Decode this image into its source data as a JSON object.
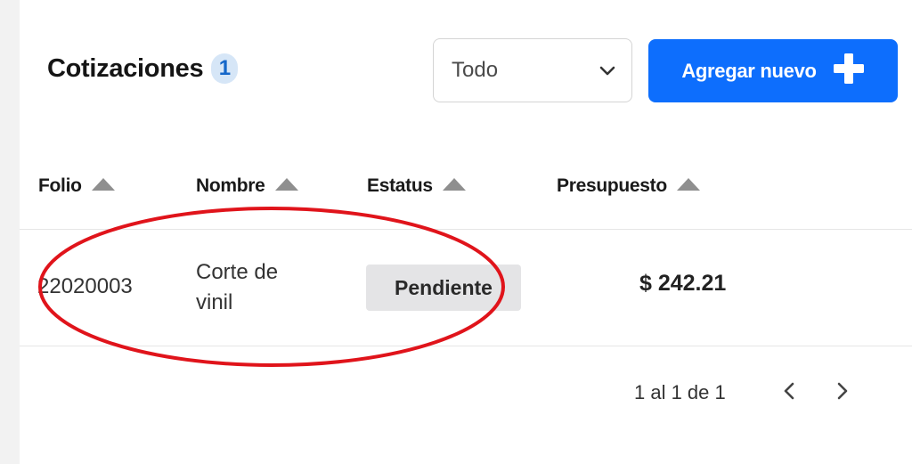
{
  "header": {
    "title": "Cotizaciones",
    "count": "1",
    "filter": {
      "selected": "Todo",
      "icon": "chevron-down-icon"
    },
    "add_button": {
      "label": "Agregar nuevo",
      "icon": "plus-icon"
    }
  },
  "table": {
    "columns": [
      {
        "label": "Folio",
        "sort_icon": "sort-up-icon"
      },
      {
        "label": "Nombre",
        "sort_icon": "sort-up-icon"
      },
      {
        "label": "Estatus",
        "sort_icon": "sort-up-icon"
      },
      {
        "label": "Presupuesto",
        "sort_icon": "sort-up-icon"
      }
    ],
    "rows": [
      {
        "folio": "22020003",
        "nombre_line1": "Corte de",
        "nombre_line2": "vinil",
        "estatus": "Pendiente",
        "presupuesto": "$ 242.21"
      }
    ]
  },
  "pagination": {
    "text": "1 al 1 de 1",
    "prev_icon": "chevron-left-icon",
    "next_icon": "chevron-right-icon"
  },
  "colors": {
    "accent": "#0d6efd",
    "badge_bg": "#e4e4e6",
    "count_badge_bg": "#d6e6f7",
    "annotation": "#e0141b"
  }
}
